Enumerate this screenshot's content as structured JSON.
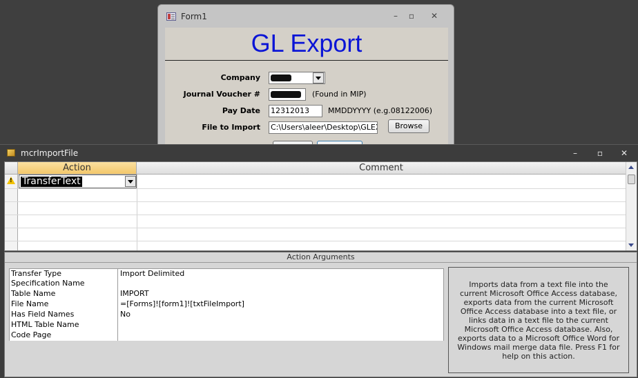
{
  "form1": {
    "title": "Form1",
    "heading": "GL Export",
    "fields": {
      "company_label": "Company",
      "voucher_label": "Journal Voucher #",
      "voucher_note": "(Found in MIP)",
      "paydate_label": "Pay Date",
      "paydate_value": "12312013",
      "paydate_note": "MMDDYYYY (e.g.08122006)",
      "file_label": "File to Import",
      "file_value": "C:\\Users\\aleer\\Desktop\\GLEXPC",
      "browse_label": "Browse"
    },
    "window_icons": {
      "minimize": "minimize-icon",
      "maximize": "maximize-icon",
      "close": "close-icon"
    }
  },
  "macro": {
    "title": "mcrImportFile",
    "grid": {
      "columns": [
        "Action",
        "Comment"
      ],
      "rows": [
        {
          "action": "TransferText",
          "comment": ""
        }
      ],
      "warning_icon": "warning-icon"
    },
    "arguments_caption": "Action Arguments",
    "arguments": [
      {
        "name": "Transfer Type",
        "value": "Import Delimited"
      },
      {
        "name": "Specification Name",
        "value": ""
      },
      {
        "name": "Table Name",
        "value": "IMPORT"
      },
      {
        "name": "File Name",
        "value": "=[Forms]![form1]![txtFileImport]"
      },
      {
        "name": "Has Field Names",
        "value": "No"
      },
      {
        "name": "HTML Table Name",
        "value": ""
      },
      {
        "name": "Code Page",
        "value": ""
      }
    ],
    "help_text": "Imports data from a text file into the current Microsoft Office Access database, exports data from the current Microsoft Office Access database into a text file, or links data in a text file to the current Microsoft Office Access database. Also, exports data to a Microsoft Office Word for Windows mail merge data file. Press F1 for help on this action."
  },
  "colors": {
    "heading": "#0a14d6",
    "action_header": "#f3c76a",
    "warning": "#f2c200"
  }
}
